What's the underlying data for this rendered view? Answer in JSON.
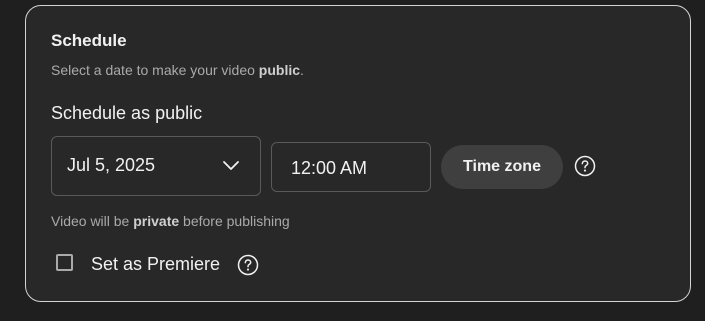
{
  "schedule": {
    "title": "Schedule",
    "subtitle_prefix": "Select a date to make your video ",
    "subtitle_bold": "public",
    "subtitle_suffix": ".",
    "section_label": "Schedule as public",
    "date_value": "Jul 5, 2025",
    "time_value": "12:00 AM",
    "timezone_label": "Time zone",
    "note_prefix": "Video will be ",
    "note_bold": "private",
    "note_suffix": " before publishing",
    "premiere_label": "Set as Premiere",
    "premiere_checked": false
  },
  "icons": {
    "date_dropdown": "chevron-down-icon",
    "timezone_help": "help-circle-icon",
    "premiere_help": "help-circle-icon"
  },
  "colors": {
    "page_background": "#1f1f1f",
    "card_background": "#282828",
    "card_border": "#d4d4d4",
    "field_border": "#5a5a5a",
    "button_background": "#3f3f3f",
    "primary_text": "#f1f1f1",
    "secondary_text": "#aaaaaa"
  }
}
